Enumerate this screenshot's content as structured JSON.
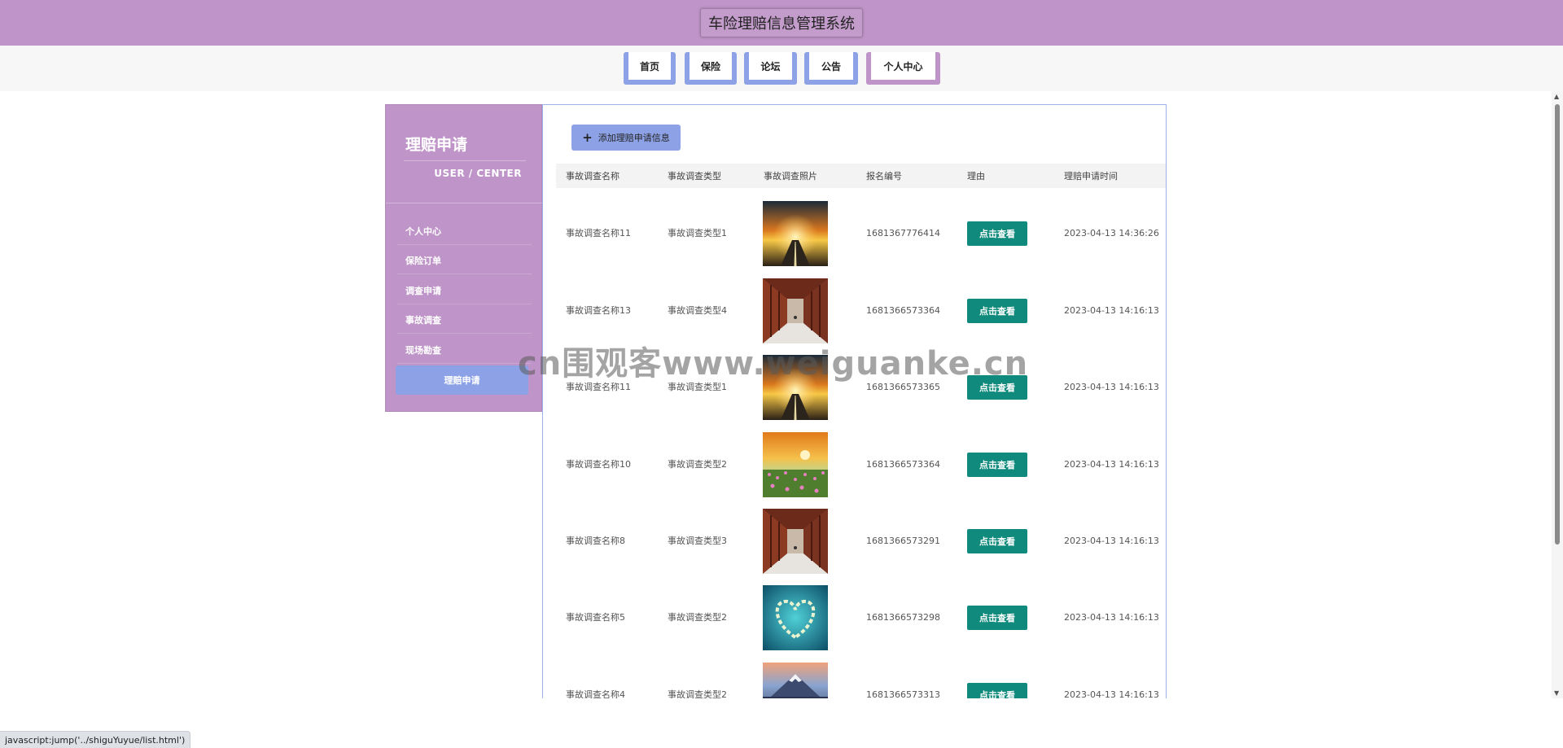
{
  "header": {
    "title": "车险理赔信息管理系统"
  },
  "nav": {
    "items": [
      {
        "label": "首页"
      },
      {
        "label": "保险"
      },
      {
        "label": "论坛"
      },
      {
        "label": "公告"
      },
      {
        "label": "个人中心"
      }
    ],
    "active_index": 4
  },
  "sidebar": {
    "title": "理赔申请",
    "subtitle": "USER / CENTER",
    "items": [
      {
        "label": "个人中心"
      },
      {
        "label": "保险订单"
      },
      {
        "label": "调查申请"
      },
      {
        "label": "事故调查"
      },
      {
        "label": "现场勘查"
      },
      {
        "label": "理赔申请"
      }
    ],
    "active_index": 5
  },
  "main": {
    "add_button_label": "添加理赔申请信息",
    "columns": [
      "事故调查名称",
      "事故调查类型",
      "事故调查照片",
      "报名编号",
      "理由",
      "理赔申请时间"
    ],
    "view_label": "点击查看",
    "rows": [
      {
        "name": "事故调查名称11",
        "type": "事故调查类型1",
        "photo": "sunset-road",
        "code": "1681367776414",
        "time": "2023-04-13 14:36:26"
      },
      {
        "name": "事故调查名称13",
        "type": "事故调查类型4",
        "photo": "corridor",
        "code": "1681366573364",
        "time": "2023-04-13 14:16:13"
      },
      {
        "name": "事故调查名称11",
        "type": "事故调查类型1",
        "photo": "sunset-road",
        "code": "1681366573365",
        "time": "2023-04-13 14:16:13"
      },
      {
        "name": "事故调查名称10",
        "type": "事故调查类型2",
        "photo": "flower-field",
        "code": "1681366573364",
        "time": "2023-04-13 14:16:13"
      },
      {
        "name": "事故调查名称8",
        "type": "事故调查类型3",
        "photo": "corridor",
        "code": "1681366573291",
        "time": "2023-04-13 14:16:13"
      },
      {
        "name": "事故调查名称5",
        "type": "事故调查类型2",
        "photo": "heart-island",
        "code": "1681366573298",
        "time": "2023-04-13 14:16:13"
      },
      {
        "name": "事故调查名称4",
        "type": "事故调查类型2",
        "photo": "mountain-city",
        "code": "1681366573313",
        "time": "2023-04-13 14:16:13"
      }
    ]
  },
  "watermark": "cn围观客www.weiguanke.cn",
  "status_bar": {
    "url": "javascript:jump('../shiguYuyue/list.html')"
  },
  "colors": {
    "header_bg": "#bf94c8",
    "nav_accent": "#8da2e6",
    "button_teal": "#0f8a7c"
  }
}
